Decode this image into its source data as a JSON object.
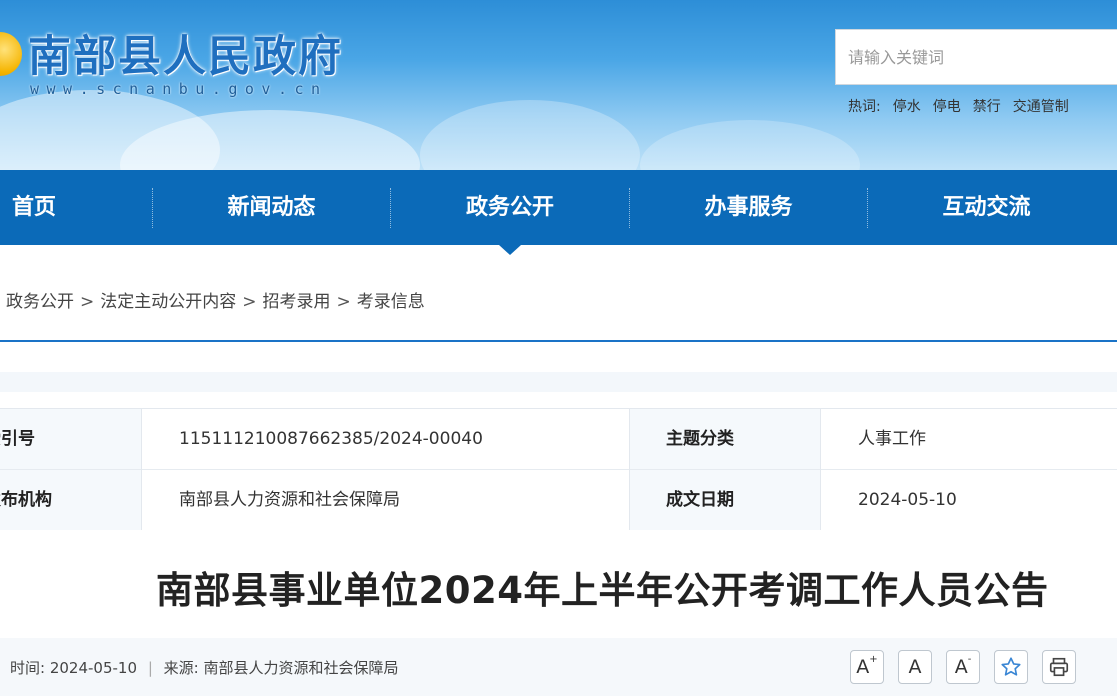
{
  "header": {
    "site_title": "南部县人民政府",
    "site_url": "www.scnanbu.gov.cn",
    "search_placeholder": "请输入关键词",
    "hot_label": "热词:",
    "hot_words": [
      "停水",
      "停电",
      "禁行",
      "交通管制"
    ]
  },
  "nav": {
    "items": [
      "首页",
      "新闻动态",
      "政务公开",
      "办事服务",
      "互动交流"
    ],
    "active": "政务公开"
  },
  "breadcrumb": [
    "政务公开",
    "法定主动公开内容",
    "招考录用",
    "考录信息"
  ],
  "breadcrumb_sep": ">",
  "meta": {
    "index_label": "索引号",
    "index_value": "115111210087662385/2024-00040",
    "topic_label": "主题分类",
    "topic_value": "人事工作",
    "publisher_label": "发布机构",
    "publisher_value": "南部县人力资源和社会保障局",
    "date_label": "成文日期",
    "date_value": "2024-05-10"
  },
  "article": {
    "title": "南部县事业单位2024年上半年公开考调工作人员公告",
    "time_label": "时间:",
    "time_value": "2024-05-10",
    "source_label": "来源:",
    "source_value": "南部县人力资源和社会保障局"
  },
  "tools": {
    "font_up": "A",
    "font_up_sup": "+",
    "font_normal": "A",
    "font_down": "A",
    "font_down_sup": "-"
  },
  "colors": {
    "nav": "#0b6ab8",
    "accent_line": "#1a73c7"
  }
}
